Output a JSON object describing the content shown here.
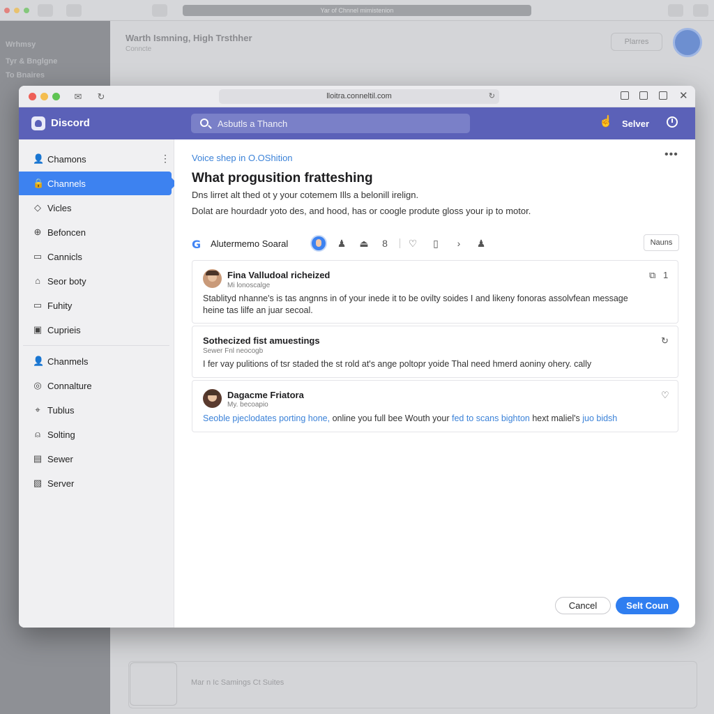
{
  "background": {
    "url": "Yar of Chnnel mimistenion",
    "sidebar_lines": [
      "Wrhmsy",
      "Tyr & Bnglgne",
      "To Bnaires"
    ],
    "title": "Warth Ismning, High Trsthher",
    "subtitle": "Conncte",
    "pill": "Plarres",
    "footer_text": "Mar n Ic Samings Ct Suites"
  },
  "window": {
    "url": "lloitra.conneltil.com"
  },
  "header": {
    "brand": "Discord",
    "search_placeholder": "Asbutls a Thanch",
    "user_label": "Selver"
  },
  "sidebar": {
    "items": [
      {
        "label": "Chamons",
        "icon": "user-icon"
      },
      {
        "label": "Channels",
        "icon": "lock-icon"
      },
      {
        "label": "Vicles",
        "icon": "diamond-icon"
      },
      {
        "label": "Befoncen",
        "icon": "globe-icon"
      },
      {
        "label": "Cannicls",
        "icon": "folder-icon"
      },
      {
        "label": "Seor boty",
        "icon": "home-icon"
      },
      {
        "label": "Fuhity",
        "icon": "folder-icon"
      },
      {
        "label": "Cuprieis",
        "icon": "note-icon"
      },
      {
        "label": "Chanmels",
        "icon": "user-icon"
      },
      {
        "label": "Connalture",
        "icon": "chat-icon"
      },
      {
        "label": "Tublus",
        "icon": "tag-icon"
      },
      {
        "label": "Solting",
        "icon": "lock-icon"
      },
      {
        "label": "Sewer",
        "icon": "list-icon"
      },
      {
        "label": "Server",
        "icon": "server-icon"
      }
    ]
  },
  "content": {
    "breadcrumb": "Voice shep in O.OShition",
    "title": "What progusition fratteshing",
    "desc1": "Dns lirret alt thed ot y your cotemem Ills a belonill irelign.",
    "desc2": "Dolat are hourdadr yoto des, and hood, has or coogle produte gloss your ip to motor.",
    "toolbar_label": "Alutermemo Soaral",
    "news_button": "Nauns",
    "cards": [
      {
        "name": "Fina Valludoal richeized",
        "meta": "Mi lonoscalge",
        "body_lines": [
          "Stablityd nhanne's is tas angnns in of your inede it to be ovilty soides I and likeny fonoras assolvfean message",
          "heine tas lilfe an juar secoal."
        ],
        "badge": "1"
      },
      {
        "name": "Sothecized fist amuestings",
        "meta": "Sewer Fnl neocogb",
        "body_lines": [
          "I fer vay pulitions of tsr staded the st rold at's ange poltopr yoide Thal need hmerd aoniny ohery. cally"
        ]
      },
      {
        "name": "Dagacme Friatora",
        "meta": "My. becoapio",
        "body_link1": "Seoble pjeclodates porting hone,",
        "body_mid": " online you full bee Wouth your ",
        "body_link2": "fed to scans bighton",
        "body_end": " hext maliel's ",
        "body_link3": "juo bidsh"
      }
    ],
    "cancel_label": "Cancel",
    "submit_label": "Selt Coun"
  },
  "colors": {
    "header": "#5b61b8",
    "accent": "#3d82f0",
    "link": "#3b82d8"
  }
}
